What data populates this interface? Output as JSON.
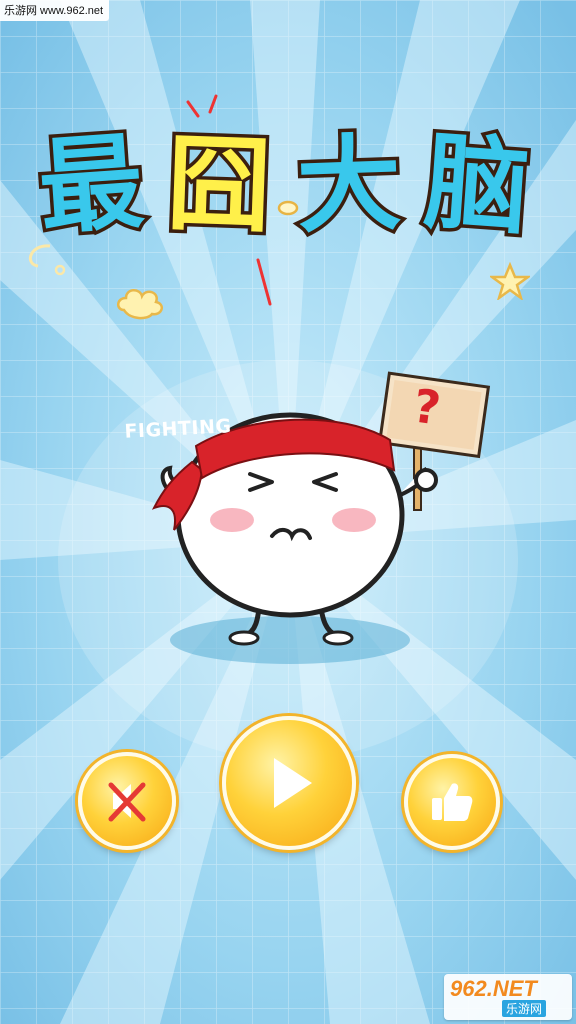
{
  "watermark_top": "乐游网 www.962.net",
  "title": {
    "chars": [
      "最",
      "囧",
      "大",
      "脑"
    ]
  },
  "mascot": {
    "headband_text": "FIGHTING",
    "sign_text": "?"
  },
  "buttons": {
    "sound": {
      "icon": "speaker-muted-icon",
      "state": "muted"
    },
    "play": {
      "icon": "play-icon"
    },
    "like": {
      "icon": "thumbs-up-icon"
    }
  },
  "watermark_bottom": {
    "brand": "962.NET",
    "sub": "乐游网"
  },
  "colors": {
    "background": "#8fd0ee",
    "title_blue": "#39c8ec",
    "title_yellow": "#fff04a",
    "button_gold": "#ffd23a",
    "headband_red": "#d8232a"
  }
}
